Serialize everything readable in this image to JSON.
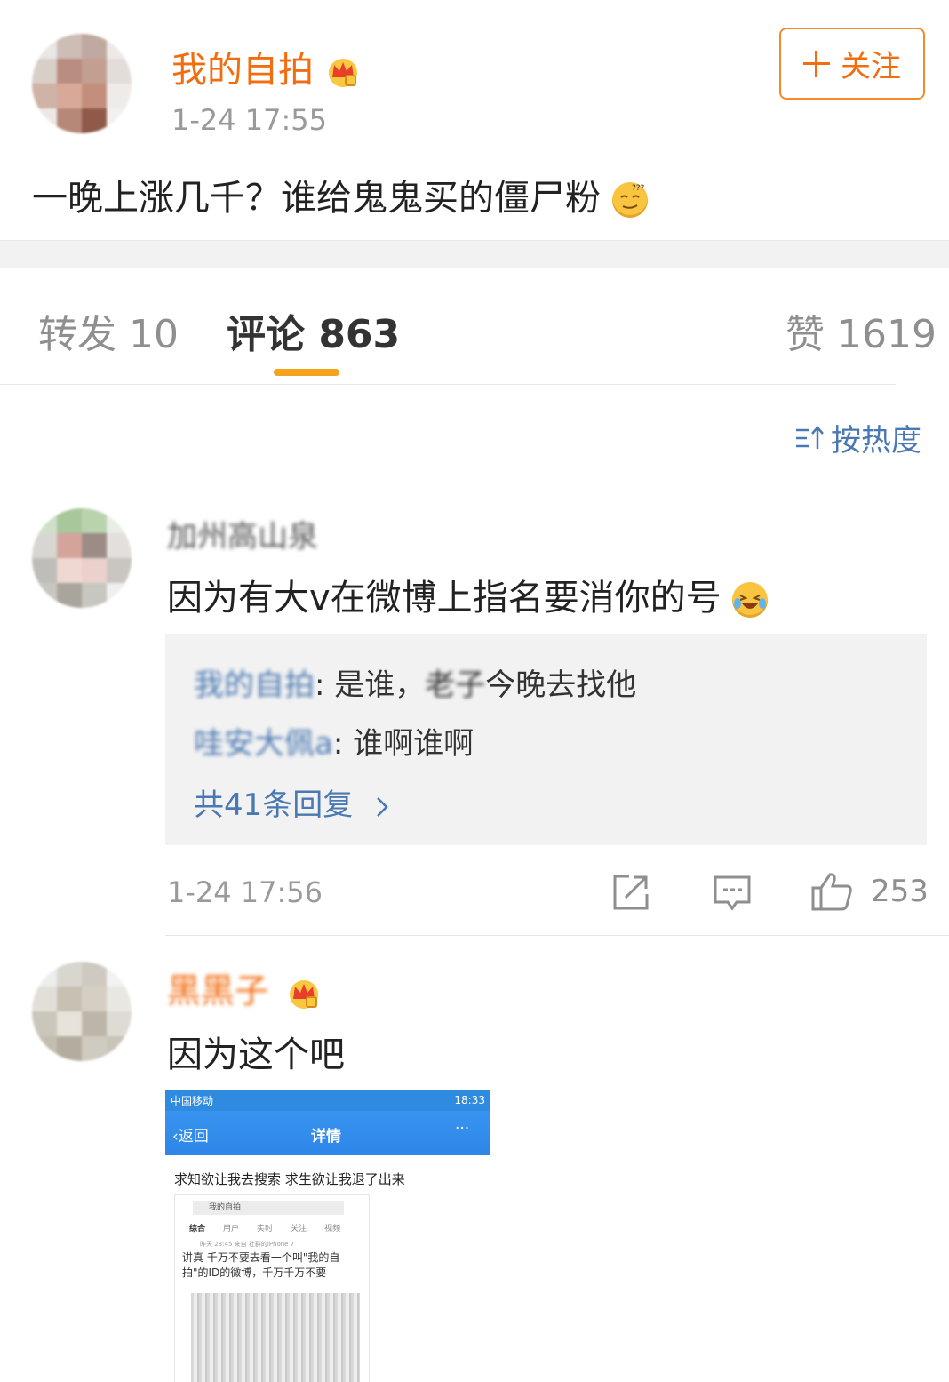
{
  "post": {
    "author": "我的自拍",
    "time": "1-24 17:55",
    "follow_label": "关注",
    "text": "一晚上涨几千？谁给鬼鬼买的僵尸粉"
  },
  "tabs": {
    "repost": "转发 10",
    "comments": "评论 863",
    "likes": "赞 1619"
  },
  "sort_label": "按热度",
  "comments": [
    {
      "author": "加州高山泉",
      "text": "因为有大v在微博上指名要消你的号",
      "replies": [
        {
          "name": "我的自拍",
          "text": ": 是谁，",
          "mid": "老子",
          "tail": "今晚去找他"
        },
        {
          "name": "哇安大佩a",
          "text": ": 谁啊谁啊"
        }
      ],
      "more_replies": "共41条回复",
      "time": "1-24 17:56",
      "likes": "253"
    },
    {
      "author": "黑黑子",
      "text": "因为这个吧",
      "image": {
        "status_left": "中国移动",
        "status_right": "18:33",
        "back_label": "返回",
        "nav_title": "详情",
        "caption": "求知欲让我去搜索  求生欲让我退了出来",
        "search_text": "我的自拍",
        "tabs": [
          "综合",
          "用户",
          "实时",
          "关注",
          "视频"
        ],
        "meta": "昨天 23:45 来自 社群的iPhone 7",
        "inner_text": "讲真 千万不要去看一个叫\"我的自拍\"的ID的微博，千万千万不要"
      }
    }
  ],
  "colors": {
    "accent": "#f26d10",
    "link": "#4a78b2",
    "tab_underline": "#f7a21b"
  }
}
